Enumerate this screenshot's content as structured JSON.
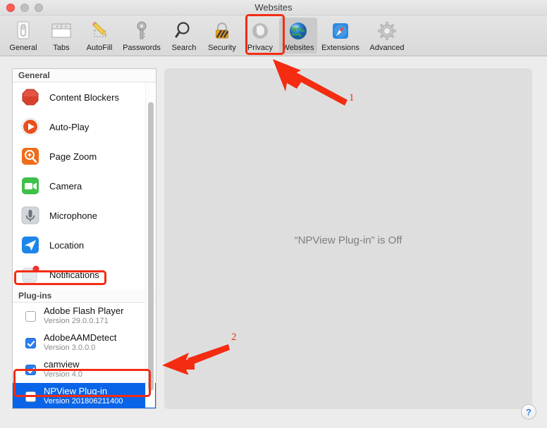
{
  "window": {
    "title": "Websites",
    "traffic_lights": [
      "close",
      "minimize",
      "zoom"
    ]
  },
  "toolbar": {
    "items": [
      {
        "label": "General",
        "icon": "general-icon",
        "selected": false
      },
      {
        "label": "Tabs",
        "icon": "tabs-icon",
        "selected": false
      },
      {
        "label": "AutoFill",
        "icon": "autofill-icon",
        "selected": false
      },
      {
        "label": "Passwords",
        "icon": "passwords-icon",
        "selected": false
      },
      {
        "label": "Search",
        "icon": "search-icon",
        "selected": false
      },
      {
        "label": "Security",
        "icon": "security-icon",
        "selected": false
      },
      {
        "label": "Privacy",
        "icon": "privacy-icon",
        "selected": false
      },
      {
        "label": "Websites",
        "icon": "websites-icon",
        "selected": true
      },
      {
        "label": "Extensions",
        "icon": "extensions-icon",
        "selected": false
      },
      {
        "label": "Advanced",
        "icon": "advanced-icon",
        "selected": false
      }
    ]
  },
  "sidebar": {
    "general_header": "General",
    "general_items": [
      {
        "label": "Content Blockers",
        "icon": "content-blockers-icon"
      },
      {
        "label": "Auto-Play",
        "icon": "auto-play-icon"
      },
      {
        "label": "Page Zoom",
        "icon": "page-zoom-icon"
      },
      {
        "label": "Camera",
        "icon": "camera-icon"
      },
      {
        "label": "Microphone",
        "icon": "microphone-icon"
      },
      {
        "label": "Location",
        "icon": "location-icon"
      },
      {
        "label": "Notifications",
        "icon": "notifications-icon"
      }
    ],
    "plugins_header": "Plug-ins",
    "plugins": [
      {
        "name": "Adobe Flash Player",
        "version": "Version 29.0.0.171",
        "checked": false,
        "selected": false
      },
      {
        "name": "AdobeAAMDetect",
        "version": "Version 3.0.0.0",
        "checked": true,
        "selected": false
      },
      {
        "name": "camview",
        "version": "Version 4.0",
        "checked": true,
        "selected": false
      },
      {
        "name": "NPView Plug-in",
        "version": "Version 201806211400",
        "checked": false,
        "selected": true
      }
    ]
  },
  "panel": {
    "message": "“NPView Plug-in” is Off"
  },
  "help": {
    "label": "?"
  },
  "annotations": {
    "marker_1": "1",
    "marker_2": "2",
    "color": "#f32c12"
  }
}
